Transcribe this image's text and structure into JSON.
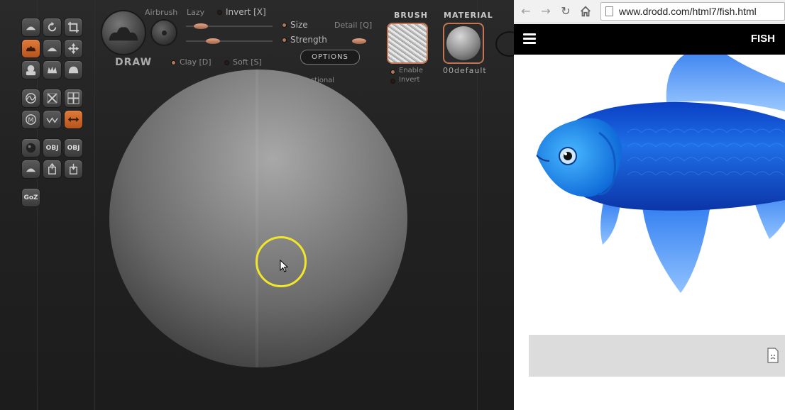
{
  "app": {
    "draw_label": "DRAW",
    "airbrush_label": "Airbrush",
    "lazy_label": "Lazy",
    "invert_label": "Invert [X]",
    "size_label": "Size",
    "detail_label": "Detail [Q]",
    "strength_label": "Strength",
    "options_label": "OPTIONS",
    "clay_label": "Clay [D]",
    "soft_label": "Soft [S]",
    "directional_label": "Directional",
    "brush_title": "BRUSH",
    "material_title": "MATERIAL",
    "enable_label": "Enable",
    "brush_invert_label": "Invert",
    "material_name": "00default",
    "goz_label": "GoZ",
    "obj_label": "OBJ",
    "accent_color": "#c96a32",
    "cursor_color": "#f2e62a"
  },
  "browser": {
    "url": "www.drodd.com/html7/fish.html",
    "back_icon": "back-arrow-icon",
    "forward_icon": "forward-arrow-icon",
    "reload_icon": "reload-icon",
    "home_icon": "home-icon",
    "site_title": "FISH",
    "menu_icon": "hamburger-menu-icon",
    "broken_image_icon": "broken-image-icon",
    "header_color": "#000000",
    "fish_color": "#1f6fe6"
  }
}
